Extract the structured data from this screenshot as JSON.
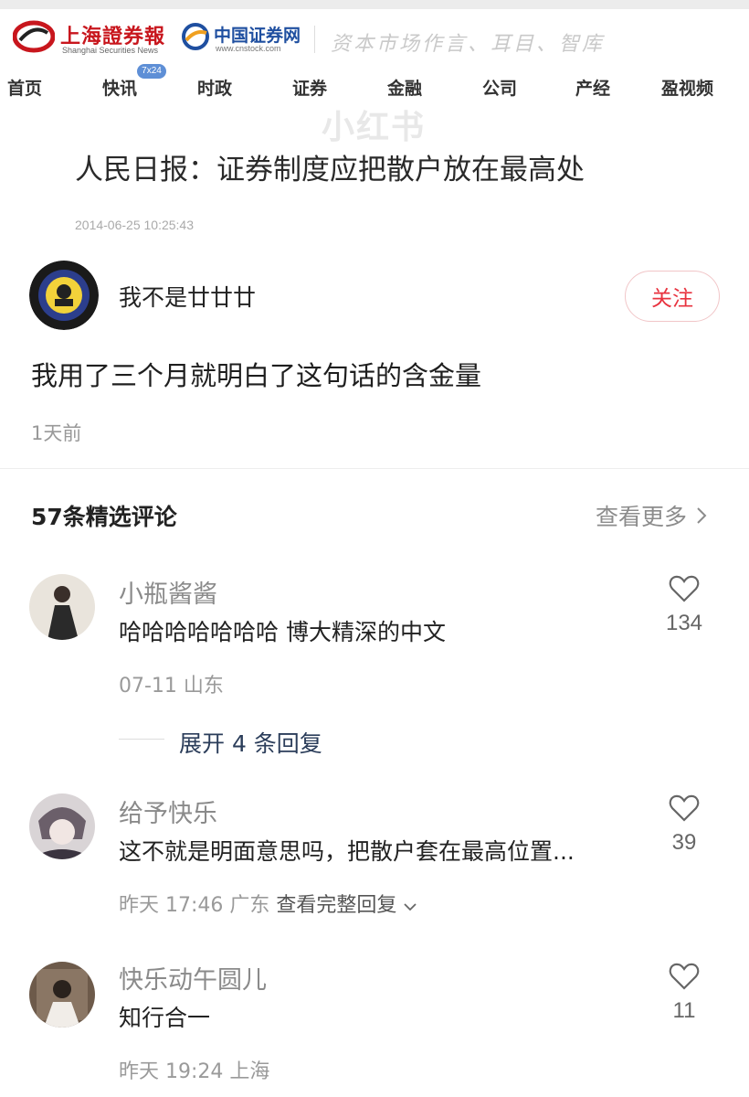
{
  "news_header": {
    "ssn_logo_cn": "上海證券報",
    "ssn_logo_en": "Shanghai Securities News",
    "cs_logo_cn": "中国证券网",
    "cs_logo_en": "www.cnstock.com",
    "slogan": "资本市场作言、耳目、智库"
  },
  "nav": {
    "items": [
      "首页",
      "快讯",
      "时政",
      "证券",
      "金融",
      "公司",
      "产经",
      "盈视频"
    ],
    "badge": "7x24"
  },
  "watermark": "小红书",
  "article": {
    "headline": "人民日报：证券制度应把散户放在最高处",
    "timestamp": "2014-06-25 10:25:43"
  },
  "post": {
    "author": "我不是廿廿廿",
    "follow_label": "关注",
    "text": "我用了三个月就明白了这句话的含金量",
    "time": "1天前"
  },
  "comments_section": {
    "title": "57条精选评论",
    "see_more": "查看更多"
  },
  "comments": [
    {
      "name": "小瓶酱酱",
      "text": "哈哈哈哈哈哈哈 博大精深的中文",
      "meta": "07-11 山东",
      "likes": "134",
      "expand_replies": "展开 4 条回复"
    },
    {
      "name": "给予快乐",
      "text": "这不就是明面意思吗，把散户套在最高位置...",
      "meta": "昨天 17:46 广东",
      "meta_link": "查看完整回复",
      "likes": "39"
    },
    {
      "name": "快乐动午圆儿",
      "text": "知行合一",
      "meta": "昨天 19:24 上海",
      "likes": "11"
    }
  ],
  "colors": {
    "brand_red": "#c8161d",
    "follow_red": "#e8333f",
    "cnstock_blue": "#1f4fa0",
    "reply_link": "#2b3d5a"
  }
}
